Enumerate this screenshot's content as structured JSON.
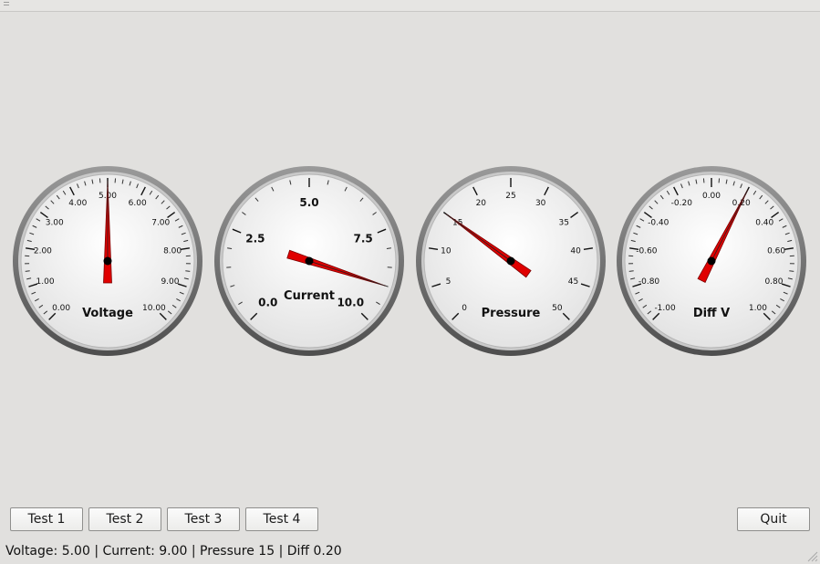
{
  "gauges": [
    {
      "title": "Voltage",
      "min": 0,
      "max": 10,
      "value": 5.0,
      "labels": [
        "0.00",
        "1.00",
        "2.00",
        "3.00",
        "4.00",
        "5.00",
        "6.00",
        "7.00",
        "8.00",
        "9.00",
        "10.00"
      ],
      "major_ticks": 11,
      "minor_per_major": 5,
      "label_font": "small"
    },
    {
      "title": "Current",
      "min": 0,
      "max": 10,
      "value": 9.0,
      "labels": [
        "0.0",
        "2.5",
        "5.0",
        "7.5",
        "10.0"
      ],
      "major_ticks": 5,
      "minor_per_major": 5,
      "label_font": "large"
    },
    {
      "title": "Pressure",
      "min": 0,
      "max": 50,
      "value": 15,
      "labels": [
        "0",
        "5",
        "10",
        "15",
        "20",
        "25",
        "30",
        "35",
        "40",
        "45",
        "50"
      ],
      "major_ticks": 11,
      "minor_per_major": 0,
      "label_font": "small"
    },
    {
      "title": "Diff V",
      "min": -1,
      "max": 1,
      "value": 0.2,
      "labels": [
        "-1.00",
        "-0.80",
        "-0.60",
        "-0.40",
        "-0.20",
        "0.00",
        "0.20",
        "0.40",
        "0.60",
        "0.80",
        "1.00"
      ],
      "major_ticks": 11,
      "minor_per_major": 5,
      "label_font": "small"
    }
  ],
  "buttons": {
    "test1": "Test 1",
    "test2": "Test 2",
    "test3": "Test 3",
    "test4": "Test 4",
    "quit": "Quit"
  },
  "status": {
    "voltage_label": "Voltage:",
    "voltage_value": "5.00",
    "current_label": "Current:",
    "current_value": "9.00",
    "pressure_label": "Pressure",
    "pressure_value": "15",
    "diff_label": "Diff",
    "diff_value": "0.20",
    "separator": "|"
  },
  "colors": {
    "background": "#e1e0de",
    "needle": "#e00000",
    "needle_outline": "#7a0000",
    "hub": "#000000",
    "bezel": "#6f6f6f",
    "face": "#f2f2f2"
  }
}
